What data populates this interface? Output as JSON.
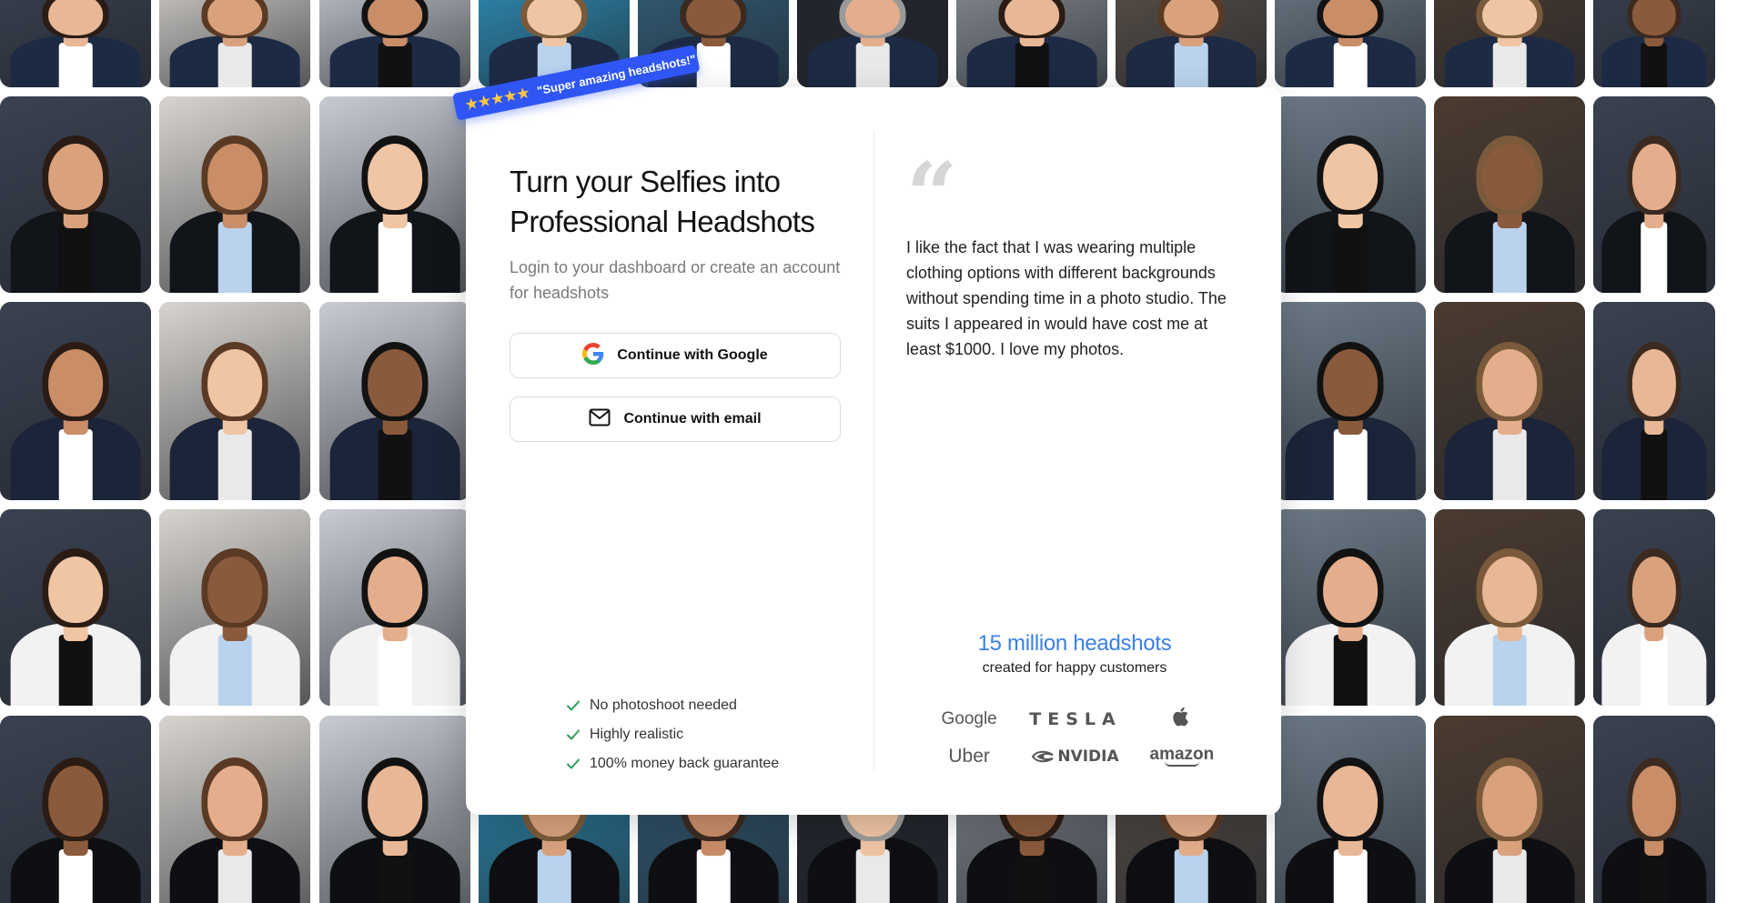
{
  "review": {
    "stars": "★★★★★",
    "quote": "\"Super amazing headshots!\""
  },
  "login": {
    "headline": "Turn your Selfies into Professional Headshots",
    "subtitle": "Login to your dashboard or create an account for headshots",
    "google_button": "Continue with Google",
    "email_button": "Continue with email",
    "google_icon": "google-g-icon",
    "email_icon": "envelope-icon"
  },
  "features": [
    "No photoshoot needed",
    "Highly realistic",
    "100% money back guarantee"
  ],
  "testimonial": {
    "quote_mark": "“",
    "text": "I like the fact that I was wearing multiple clothing options with different backgrounds without spending time in a photo studio. The suits I appeared in would have cost me at least $1000. I love my photos."
  },
  "stats": {
    "number": "15 million headshots",
    "caption": "created for happy customers"
  },
  "logos": {
    "google": "Google",
    "tesla": "TESLA",
    "apple": "apple-logo-icon",
    "uber": "Uber",
    "nvidia": "NVIDIA",
    "amazon": "amazon"
  },
  "colors": {
    "accent_blue": "#3b7fe6",
    "ribbon_blue": "#2f56f5",
    "check_green": "#2e9e5b",
    "star_yellow": "#ffc83d"
  }
}
